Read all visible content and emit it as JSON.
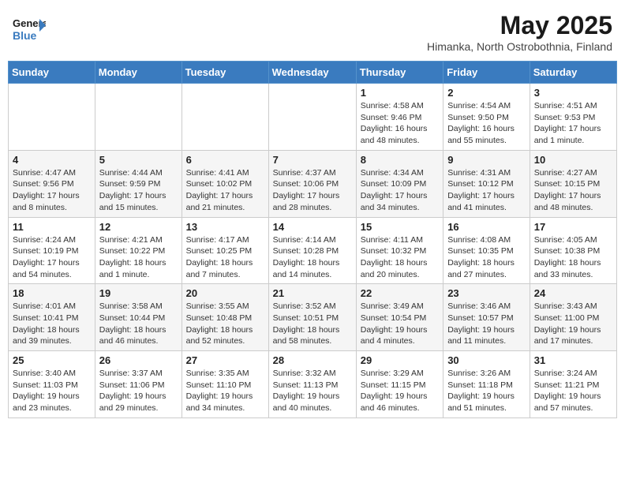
{
  "header": {
    "logo_line1": "General",
    "logo_line2": "Blue",
    "month_title": "May 2025",
    "subtitle": "Himanka, North Ostrobothnia, Finland"
  },
  "weekdays": [
    "Sunday",
    "Monday",
    "Tuesday",
    "Wednesday",
    "Thursday",
    "Friday",
    "Saturday"
  ],
  "weeks": [
    [
      {
        "day": "",
        "info": ""
      },
      {
        "day": "",
        "info": ""
      },
      {
        "day": "",
        "info": ""
      },
      {
        "day": "",
        "info": ""
      },
      {
        "day": "1",
        "info": "Sunrise: 4:58 AM\nSunset: 9:46 PM\nDaylight: 16 hours\nand 48 minutes."
      },
      {
        "day": "2",
        "info": "Sunrise: 4:54 AM\nSunset: 9:50 PM\nDaylight: 16 hours\nand 55 minutes."
      },
      {
        "day": "3",
        "info": "Sunrise: 4:51 AM\nSunset: 9:53 PM\nDaylight: 17 hours\nand 1 minute."
      }
    ],
    [
      {
        "day": "4",
        "info": "Sunrise: 4:47 AM\nSunset: 9:56 PM\nDaylight: 17 hours\nand 8 minutes."
      },
      {
        "day": "5",
        "info": "Sunrise: 4:44 AM\nSunset: 9:59 PM\nDaylight: 17 hours\nand 15 minutes."
      },
      {
        "day": "6",
        "info": "Sunrise: 4:41 AM\nSunset: 10:02 PM\nDaylight: 17 hours\nand 21 minutes."
      },
      {
        "day": "7",
        "info": "Sunrise: 4:37 AM\nSunset: 10:06 PM\nDaylight: 17 hours\nand 28 minutes."
      },
      {
        "day": "8",
        "info": "Sunrise: 4:34 AM\nSunset: 10:09 PM\nDaylight: 17 hours\nand 34 minutes."
      },
      {
        "day": "9",
        "info": "Sunrise: 4:31 AM\nSunset: 10:12 PM\nDaylight: 17 hours\nand 41 minutes."
      },
      {
        "day": "10",
        "info": "Sunrise: 4:27 AM\nSunset: 10:15 PM\nDaylight: 17 hours\nand 48 minutes."
      }
    ],
    [
      {
        "day": "11",
        "info": "Sunrise: 4:24 AM\nSunset: 10:19 PM\nDaylight: 17 hours\nand 54 minutes."
      },
      {
        "day": "12",
        "info": "Sunrise: 4:21 AM\nSunset: 10:22 PM\nDaylight: 18 hours\nand 1 minute."
      },
      {
        "day": "13",
        "info": "Sunrise: 4:17 AM\nSunset: 10:25 PM\nDaylight: 18 hours\nand 7 minutes."
      },
      {
        "day": "14",
        "info": "Sunrise: 4:14 AM\nSunset: 10:28 PM\nDaylight: 18 hours\nand 14 minutes."
      },
      {
        "day": "15",
        "info": "Sunrise: 4:11 AM\nSunset: 10:32 PM\nDaylight: 18 hours\nand 20 minutes."
      },
      {
        "day": "16",
        "info": "Sunrise: 4:08 AM\nSunset: 10:35 PM\nDaylight: 18 hours\nand 27 minutes."
      },
      {
        "day": "17",
        "info": "Sunrise: 4:05 AM\nSunset: 10:38 PM\nDaylight: 18 hours\nand 33 minutes."
      }
    ],
    [
      {
        "day": "18",
        "info": "Sunrise: 4:01 AM\nSunset: 10:41 PM\nDaylight: 18 hours\nand 39 minutes."
      },
      {
        "day": "19",
        "info": "Sunrise: 3:58 AM\nSunset: 10:44 PM\nDaylight: 18 hours\nand 46 minutes."
      },
      {
        "day": "20",
        "info": "Sunrise: 3:55 AM\nSunset: 10:48 PM\nDaylight: 18 hours\nand 52 minutes."
      },
      {
        "day": "21",
        "info": "Sunrise: 3:52 AM\nSunset: 10:51 PM\nDaylight: 18 hours\nand 58 minutes."
      },
      {
        "day": "22",
        "info": "Sunrise: 3:49 AM\nSunset: 10:54 PM\nDaylight: 19 hours\nand 4 minutes."
      },
      {
        "day": "23",
        "info": "Sunrise: 3:46 AM\nSunset: 10:57 PM\nDaylight: 19 hours\nand 11 minutes."
      },
      {
        "day": "24",
        "info": "Sunrise: 3:43 AM\nSunset: 11:00 PM\nDaylight: 19 hours\nand 17 minutes."
      }
    ],
    [
      {
        "day": "25",
        "info": "Sunrise: 3:40 AM\nSunset: 11:03 PM\nDaylight: 19 hours\nand 23 minutes."
      },
      {
        "day": "26",
        "info": "Sunrise: 3:37 AM\nSunset: 11:06 PM\nDaylight: 19 hours\nand 29 minutes."
      },
      {
        "day": "27",
        "info": "Sunrise: 3:35 AM\nSunset: 11:10 PM\nDaylight: 19 hours\nand 34 minutes."
      },
      {
        "day": "28",
        "info": "Sunrise: 3:32 AM\nSunset: 11:13 PM\nDaylight: 19 hours\nand 40 minutes."
      },
      {
        "day": "29",
        "info": "Sunrise: 3:29 AM\nSunset: 11:15 PM\nDaylight: 19 hours\nand 46 minutes."
      },
      {
        "day": "30",
        "info": "Sunrise: 3:26 AM\nSunset: 11:18 PM\nDaylight: 19 hours\nand 51 minutes."
      },
      {
        "day": "31",
        "info": "Sunrise: 3:24 AM\nSunset: 11:21 PM\nDaylight: 19 hours\nand 57 minutes."
      }
    ]
  ]
}
